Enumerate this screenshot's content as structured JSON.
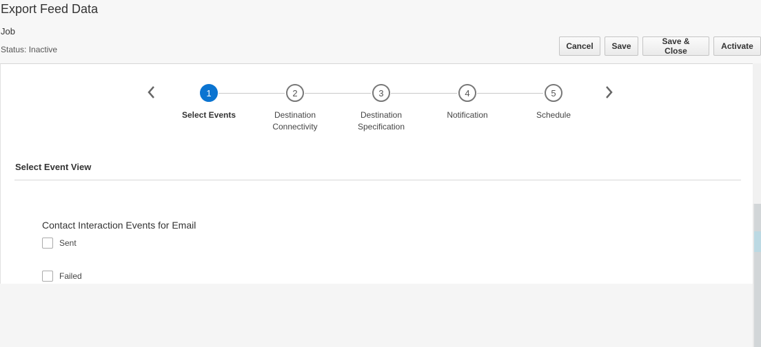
{
  "header": {
    "title": "Export Feed Data",
    "subtitle": "Job",
    "status": "Status: Inactive"
  },
  "toolbar": {
    "cancel_label": "Cancel",
    "save_label": "Save",
    "save_close_label": "Save & Close",
    "activate_label": "Activate"
  },
  "wizard": {
    "prev_icon": "chevron-left-icon",
    "next_icon": "chevron-right-icon",
    "steps": [
      {
        "number": "1",
        "line1": "Select Events",
        "line2": "",
        "active": true
      },
      {
        "number": "2",
        "line1": "Destination",
        "line2": "Connectivity",
        "active": false
      },
      {
        "number": "3",
        "line1": "Destination",
        "line2": "Specification",
        "active": false
      },
      {
        "number": "4",
        "line1": "Notification",
        "line2": "",
        "active": false
      },
      {
        "number": "5",
        "line1": "Schedule",
        "line2": "",
        "active": false
      }
    ]
  },
  "main": {
    "section_title": "Select Event View",
    "group_title": "Contact Interaction Events for Email",
    "checkboxes": [
      {
        "label": "Sent",
        "checked": false
      },
      {
        "label": "Failed",
        "checked": false
      }
    ]
  },
  "colors": {
    "accent": "#0b74d1"
  }
}
